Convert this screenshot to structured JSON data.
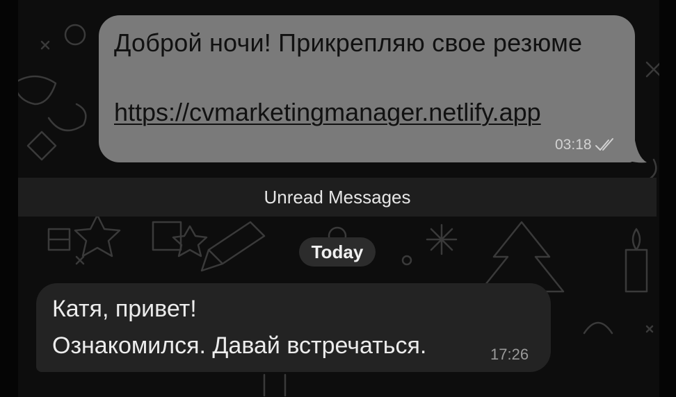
{
  "outgoing_message": {
    "text": "Доброй ночи! Прикрепляю свое резюме",
    "link": "https://cvmarketingmanager.netlify.app",
    "time": "03:18",
    "status_icon": "double-check-icon"
  },
  "unread_divider": {
    "label": "Unread Messages"
  },
  "date_separator": {
    "label": "Today"
  },
  "incoming_message": {
    "line1": "Катя, привет!",
    "line2": "Ознакомился. Давай встречаться.",
    "time": "17:26"
  },
  "colors": {
    "background": "#0d0d0d",
    "outgoing_bubble": "#7a7a7a",
    "incoming_bubble": "#232323",
    "divider_bar": "#1e1e1e"
  }
}
